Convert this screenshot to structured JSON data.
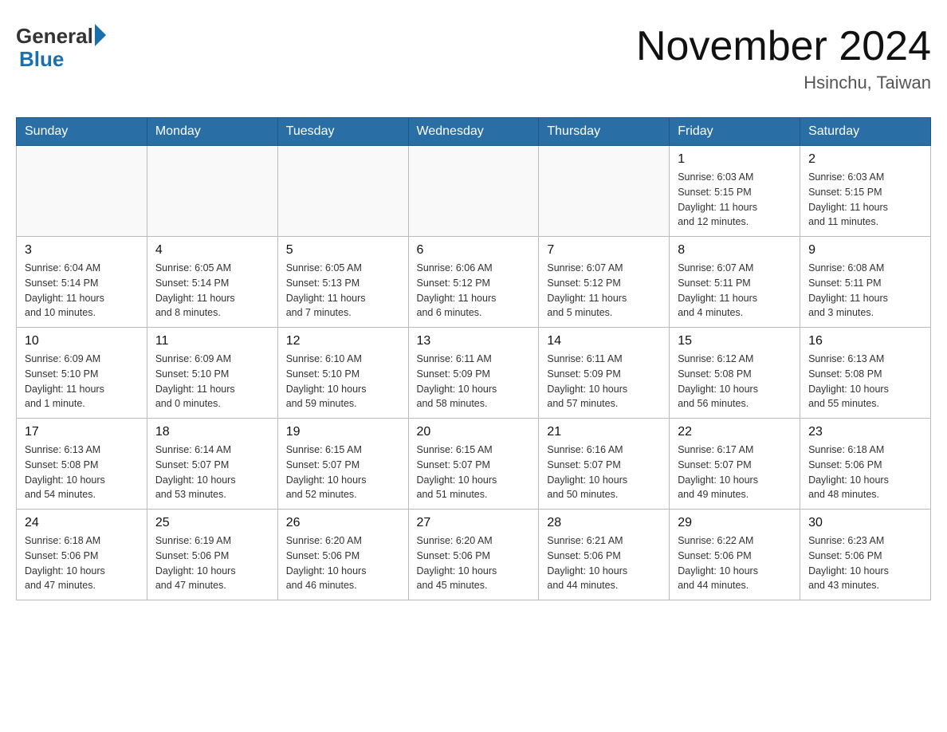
{
  "header": {
    "logo_general": "General",
    "logo_blue": "Blue",
    "title": "November 2024",
    "location": "Hsinchu, Taiwan"
  },
  "days_of_week": [
    "Sunday",
    "Monday",
    "Tuesday",
    "Wednesday",
    "Thursday",
    "Friday",
    "Saturday"
  ],
  "weeks": [
    [
      {
        "day": "",
        "info": ""
      },
      {
        "day": "",
        "info": ""
      },
      {
        "day": "",
        "info": ""
      },
      {
        "day": "",
        "info": ""
      },
      {
        "day": "",
        "info": ""
      },
      {
        "day": "1",
        "info": "Sunrise: 6:03 AM\nSunset: 5:15 PM\nDaylight: 11 hours\nand 12 minutes."
      },
      {
        "day": "2",
        "info": "Sunrise: 6:03 AM\nSunset: 5:15 PM\nDaylight: 11 hours\nand 11 minutes."
      }
    ],
    [
      {
        "day": "3",
        "info": "Sunrise: 6:04 AM\nSunset: 5:14 PM\nDaylight: 11 hours\nand 10 minutes."
      },
      {
        "day": "4",
        "info": "Sunrise: 6:05 AM\nSunset: 5:14 PM\nDaylight: 11 hours\nand 8 minutes."
      },
      {
        "day": "5",
        "info": "Sunrise: 6:05 AM\nSunset: 5:13 PM\nDaylight: 11 hours\nand 7 minutes."
      },
      {
        "day": "6",
        "info": "Sunrise: 6:06 AM\nSunset: 5:12 PM\nDaylight: 11 hours\nand 6 minutes."
      },
      {
        "day": "7",
        "info": "Sunrise: 6:07 AM\nSunset: 5:12 PM\nDaylight: 11 hours\nand 5 minutes."
      },
      {
        "day": "8",
        "info": "Sunrise: 6:07 AM\nSunset: 5:11 PM\nDaylight: 11 hours\nand 4 minutes."
      },
      {
        "day": "9",
        "info": "Sunrise: 6:08 AM\nSunset: 5:11 PM\nDaylight: 11 hours\nand 3 minutes."
      }
    ],
    [
      {
        "day": "10",
        "info": "Sunrise: 6:09 AM\nSunset: 5:10 PM\nDaylight: 11 hours\nand 1 minute."
      },
      {
        "day": "11",
        "info": "Sunrise: 6:09 AM\nSunset: 5:10 PM\nDaylight: 11 hours\nand 0 minutes."
      },
      {
        "day": "12",
        "info": "Sunrise: 6:10 AM\nSunset: 5:10 PM\nDaylight: 10 hours\nand 59 minutes."
      },
      {
        "day": "13",
        "info": "Sunrise: 6:11 AM\nSunset: 5:09 PM\nDaylight: 10 hours\nand 58 minutes."
      },
      {
        "day": "14",
        "info": "Sunrise: 6:11 AM\nSunset: 5:09 PM\nDaylight: 10 hours\nand 57 minutes."
      },
      {
        "day": "15",
        "info": "Sunrise: 6:12 AM\nSunset: 5:08 PM\nDaylight: 10 hours\nand 56 minutes."
      },
      {
        "day": "16",
        "info": "Sunrise: 6:13 AM\nSunset: 5:08 PM\nDaylight: 10 hours\nand 55 minutes."
      }
    ],
    [
      {
        "day": "17",
        "info": "Sunrise: 6:13 AM\nSunset: 5:08 PM\nDaylight: 10 hours\nand 54 minutes."
      },
      {
        "day": "18",
        "info": "Sunrise: 6:14 AM\nSunset: 5:07 PM\nDaylight: 10 hours\nand 53 minutes."
      },
      {
        "day": "19",
        "info": "Sunrise: 6:15 AM\nSunset: 5:07 PM\nDaylight: 10 hours\nand 52 minutes."
      },
      {
        "day": "20",
        "info": "Sunrise: 6:15 AM\nSunset: 5:07 PM\nDaylight: 10 hours\nand 51 minutes."
      },
      {
        "day": "21",
        "info": "Sunrise: 6:16 AM\nSunset: 5:07 PM\nDaylight: 10 hours\nand 50 minutes."
      },
      {
        "day": "22",
        "info": "Sunrise: 6:17 AM\nSunset: 5:07 PM\nDaylight: 10 hours\nand 49 minutes."
      },
      {
        "day": "23",
        "info": "Sunrise: 6:18 AM\nSunset: 5:06 PM\nDaylight: 10 hours\nand 48 minutes."
      }
    ],
    [
      {
        "day": "24",
        "info": "Sunrise: 6:18 AM\nSunset: 5:06 PM\nDaylight: 10 hours\nand 47 minutes."
      },
      {
        "day": "25",
        "info": "Sunrise: 6:19 AM\nSunset: 5:06 PM\nDaylight: 10 hours\nand 47 minutes."
      },
      {
        "day": "26",
        "info": "Sunrise: 6:20 AM\nSunset: 5:06 PM\nDaylight: 10 hours\nand 46 minutes."
      },
      {
        "day": "27",
        "info": "Sunrise: 6:20 AM\nSunset: 5:06 PM\nDaylight: 10 hours\nand 45 minutes."
      },
      {
        "day": "28",
        "info": "Sunrise: 6:21 AM\nSunset: 5:06 PM\nDaylight: 10 hours\nand 44 minutes."
      },
      {
        "day": "29",
        "info": "Sunrise: 6:22 AM\nSunset: 5:06 PM\nDaylight: 10 hours\nand 44 minutes."
      },
      {
        "day": "30",
        "info": "Sunrise: 6:23 AM\nSunset: 5:06 PM\nDaylight: 10 hours\nand 43 minutes."
      }
    ]
  ]
}
